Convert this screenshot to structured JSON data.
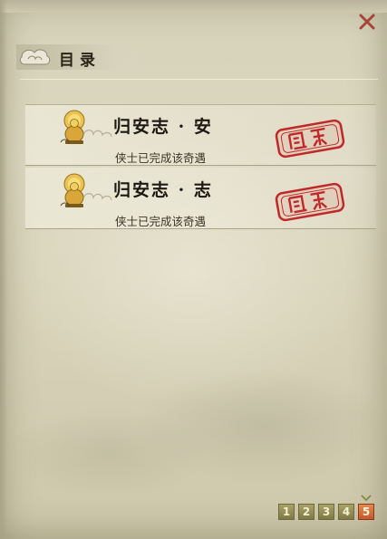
{
  "panel": {
    "title": "目录",
    "close_icon": "close-x-icon"
  },
  "entries": [
    {
      "name": "归安志 · 安",
      "status": "侠士已完成该奇遇",
      "icon": "golden-buddha-icon",
      "stamp": "completed-seal-stamp"
    },
    {
      "name": "归安志 · 志",
      "status": "侠士已完成该奇遇",
      "icon": "golden-buddha-icon",
      "stamp": "completed-seal-stamp"
    }
  ],
  "pagination": {
    "pages": [
      "1",
      "2",
      "3",
      "4",
      "5"
    ],
    "current": "5"
  },
  "colors": {
    "parchment": "#d7d2b8",
    "title_text": "#2b2417",
    "seal_red": "#c0282a",
    "page_button": "#8f894f",
    "page_button_active": "#d46a36",
    "close_red": "#a8453a"
  }
}
